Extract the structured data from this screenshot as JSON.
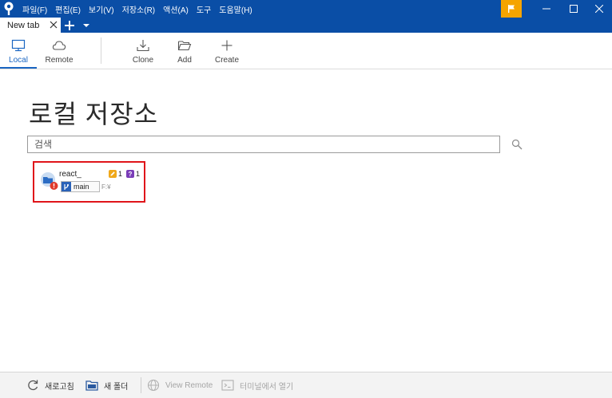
{
  "window": {
    "menu": [
      "파일(F)",
      "편집(E)",
      "보기(V)",
      "저장소(R)",
      "액션(A)",
      "도구",
      "도움말(H)"
    ]
  },
  "tabs": {
    "active_label": "New tab"
  },
  "toolbar": {
    "local_label": "Local",
    "remote_label": "Remote",
    "clone_label": "Clone",
    "add_label": "Add",
    "create_label": "Create"
  },
  "main": {
    "title": "로컬 저장소",
    "search_placeholder": "검색"
  },
  "repo": {
    "name": "react_",
    "modified_count": "1",
    "unknown_count": "1",
    "unknown_symbol": "?",
    "branch": "main",
    "hint": "F:¥"
  },
  "bottombar": {
    "refresh_label": "새로고침",
    "new_folder_label": "새 폴더",
    "view_remote_label": "View Remote",
    "terminal_label": "터미널에서 열기"
  },
  "colors": {
    "titlebar": "#0a4ea6",
    "flag": "#f5a400",
    "accent": "#1a66c2",
    "highlight_border": "#e0141a",
    "modified": "#f0a81a",
    "unknown": "#7a3db8"
  }
}
